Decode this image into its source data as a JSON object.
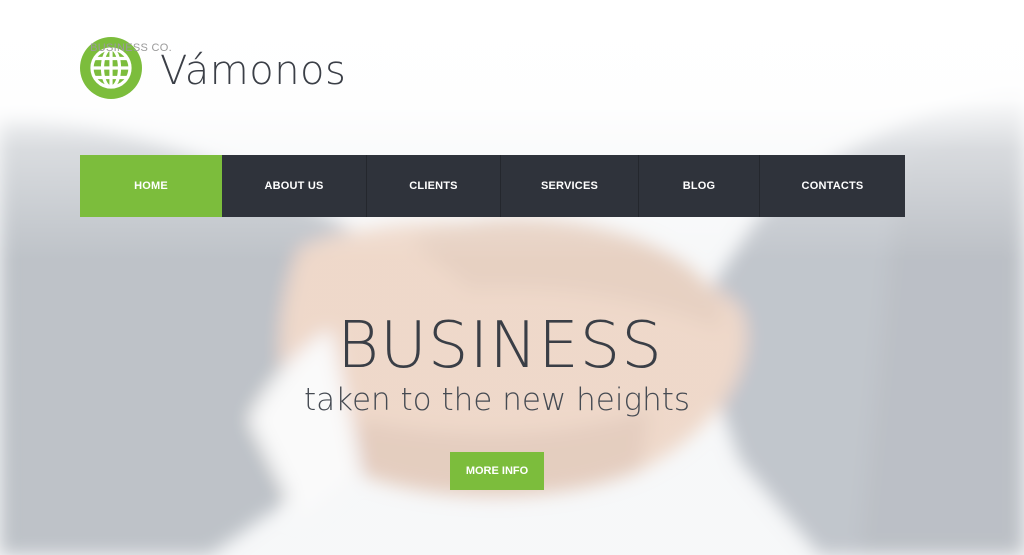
{
  "brand": {
    "tagline": "BUSINESS CO.",
    "name": "Vámonos",
    "logo_icon": "globe-icon",
    "accent_color": "#7cbd3c"
  },
  "nav": {
    "background_color": "#2f333b",
    "items": [
      {
        "label": "HOME",
        "active": true
      },
      {
        "label": "ABOUT US",
        "active": false
      },
      {
        "label": "CLIENTS",
        "active": false
      },
      {
        "label": "SERVICES",
        "active": false
      },
      {
        "label": "BLOG",
        "active": false
      },
      {
        "label": "CONTACTS",
        "active": false
      }
    ]
  },
  "hero": {
    "background": "handshake-photo",
    "title": "BUSINESS",
    "subtitle": "taken to the new heights",
    "cta_label": "MORE INFO"
  }
}
